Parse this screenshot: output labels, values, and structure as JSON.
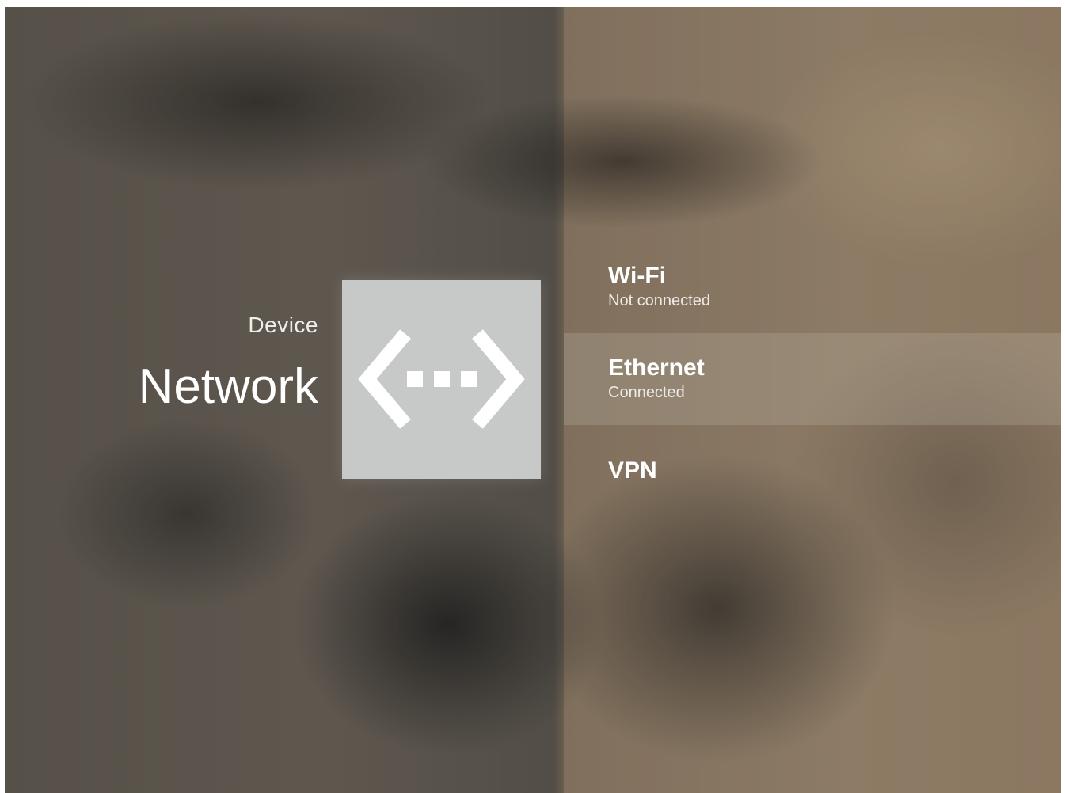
{
  "header": {
    "breadcrumb": "Device",
    "title": "Network"
  },
  "icon": {
    "name": "network-icon",
    "tile_color": "#c6c9c8",
    "glyph_color": "#ffffff"
  },
  "menu": {
    "items": [
      {
        "title": "Wi-Fi",
        "subtitle": "Not connected"
      },
      {
        "title": "Ethernet",
        "subtitle": "Connected"
      },
      {
        "title": "VPN"
      }
    ],
    "focused_index": 1
  }
}
